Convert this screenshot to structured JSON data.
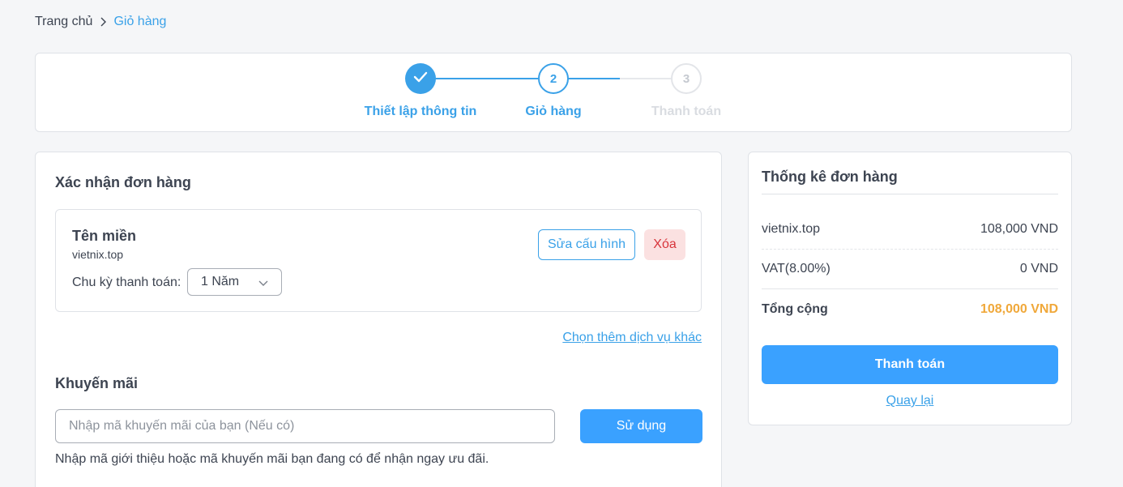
{
  "breadcrumb": {
    "home": "Trang chủ",
    "current": "Giỏ hàng"
  },
  "stepper": {
    "steps": [
      {
        "number": "1",
        "label": "Thiết lập thông tin",
        "state": "done"
      },
      {
        "number": "2",
        "label": "Giỏ hàng",
        "state": "active"
      },
      {
        "number": "3",
        "label": "Thanh toán",
        "state": "todo"
      }
    ]
  },
  "order": {
    "title": "Xác nhận đơn hàng",
    "item": {
      "name": "Tên miền",
      "domain": "vietnix.top",
      "cycle_label": "Chu kỳ thanh toán:",
      "cycle_value": "1 Năm",
      "edit_label": "Sửa cấu hình",
      "delete_label": "Xóa"
    },
    "more_services_link": "Chọn thêm dịch vụ khác"
  },
  "promo": {
    "title": "Khuyến mãi",
    "placeholder": "Nhập mã khuyến mãi của bạn (Nếu có)",
    "apply_label": "Sử dụng",
    "hint": "Nhập mã giới thiệu hoặc mã khuyến mãi bạn đang có để nhận ngay ưu đãi."
  },
  "summary": {
    "title": "Thống kê đơn hàng",
    "rows": [
      {
        "label": "vietnix.top",
        "value": "108,000 VND"
      },
      {
        "label": "VAT(8.00%)",
        "value": "0 VND"
      }
    ],
    "total_label": "Tổng cộng",
    "total_value": "108,000 VND",
    "pay_label": "Thanh toán",
    "back_label": "Quay lại"
  },
  "colors": {
    "primary": "#3aa1e8",
    "button": "#3aa1ff",
    "danger": "#d8343b",
    "total": "#f0a83a"
  },
  "icons": {
    "step_done": "check-icon",
    "breadcrumb_sep": "chevron-right-icon",
    "select": "chevron-down-icon"
  }
}
